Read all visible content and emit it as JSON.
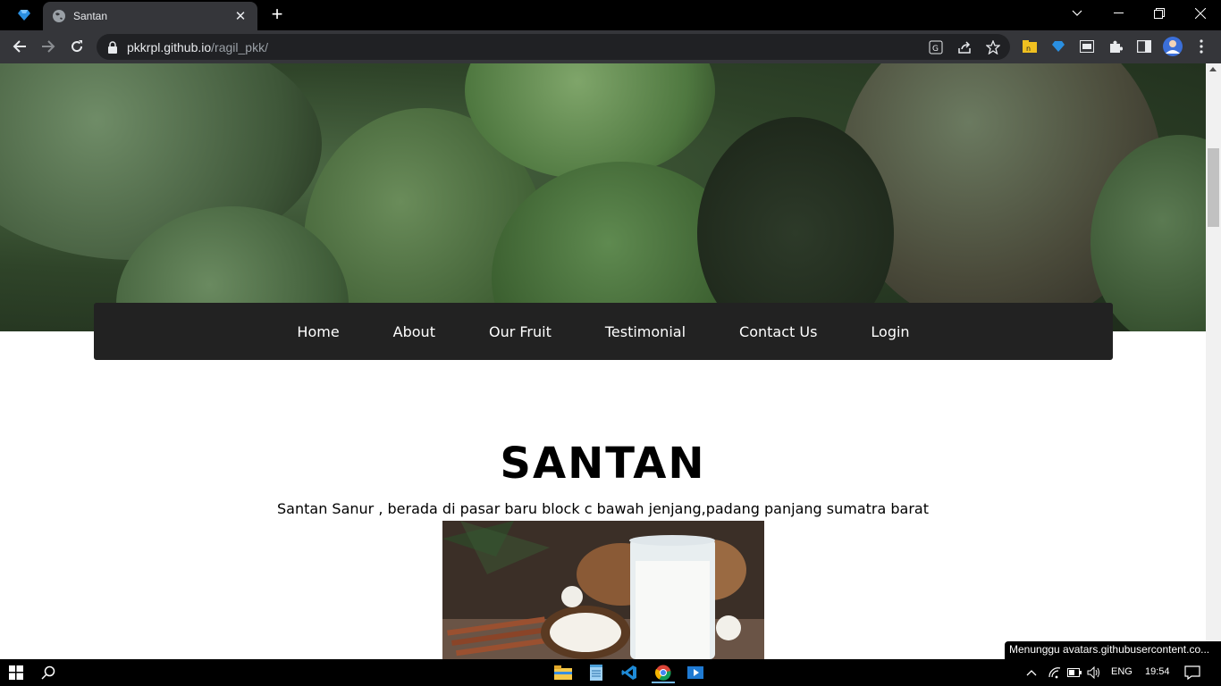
{
  "browser": {
    "pinned_tab_icon": "sapphire-gem-icon",
    "active_tab": {
      "title": "Santan",
      "icon": "globe-icon"
    },
    "url_host": "pkkrpl.github.io",
    "url_path": "/ragil_pkk/",
    "window_controls": [
      "chevron-down-icon",
      "minimize-icon",
      "restore-icon",
      "close-icon"
    ]
  },
  "nav": {
    "items": [
      {
        "label": "Home"
      },
      {
        "label": "About"
      },
      {
        "label": "Our Fruit"
      },
      {
        "label": "Testimonial"
      },
      {
        "label": "Contact Us"
      },
      {
        "label": "Login"
      }
    ]
  },
  "content": {
    "title": "SANTAN",
    "subtitle": "Santan Sanur , berada di pasar baru block c bawah jenjang,padang panjang sumatra barat"
  },
  "status_bar": {
    "text": "Menunggu avatars.githubusercontent.co..."
  },
  "taskbar": {
    "language": "ENG",
    "time": "19:54"
  },
  "colors": {
    "navbar_bg": "#222222",
    "page_bg": "#ffffff",
    "chrome_dark": "#35363a"
  }
}
